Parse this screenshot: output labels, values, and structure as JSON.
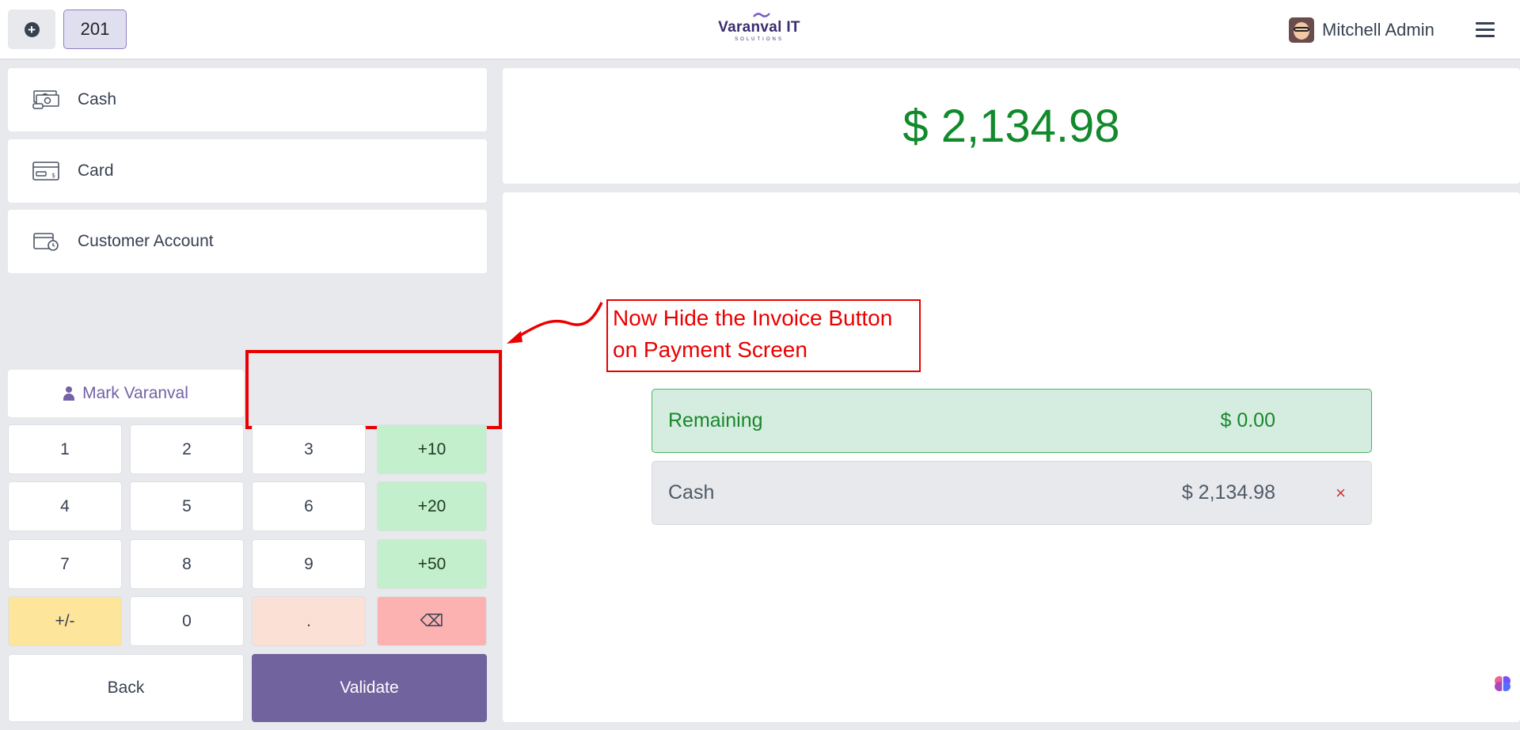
{
  "header": {
    "table_number": "201",
    "logo_line1": "Varanval IT",
    "logo_line2": "SOLUTIONS",
    "user_name": "Mitchell Admin"
  },
  "payment_methods": [
    {
      "label": "Cash",
      "icon": "cash-icon"
    },
    {
      "label": "Card",
      "icon": "card-icon"
    },
    {
      "label": "Customer Account",
      "icon": "wallet-clock-icon"
    }
  ],
  "customer": {
    "name": "Mark Varanval",
    "icon": "person-icon"
  },
  "numpad": {
    "keys": [
      "1",
      "2",
      "3",
      "+10",
      "4",
      "5",
      "6",
      "+20",
      "7",
      "8",
      "9",
      "+50",
      "+/-",
      "0",
      ".",
      "⌫"
    ],
    "back_label": "Back",
    "validate_label": "Validate"
  },
  "summary": {
    "total": "$ 2,134.98",
    "lines": [
      {
        "label": "Remaining",
        "amount": "$ 0.00"
      },
      {
        "label": "Cash",
        "amount": "$ 2,134.98",
        "remove_glyph": "×"
      }
    ]
  },
  "annotation": {
    "line1": "Now Hide the Invoice Button",
    "line2": "on Payment Screen"
  },
  "colors": {
    "accent": "#71639e",
    "total_green": "#128a2c",
    "annotation_red": "#ea0000"
  }
}
